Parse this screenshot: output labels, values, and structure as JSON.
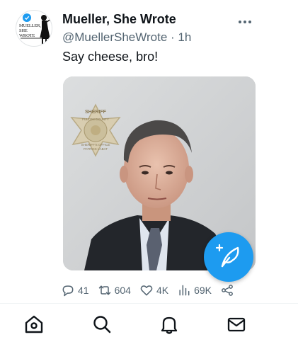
{
  "tweet": {
    "avatar_text": "Mueller, She Wrote",
    "display_name": "Mueller, She Wrote",
    "handle": "@MuellerSheWrote",
    "separator": "·",
    "time": "1h",
    "text": "Say cheese, bro!",
    "media": {
      "badge_label": "SHERIFF",
      "badge_county": "FULTON COUNTY",
      "badge_office": "SHERIFF'S OFFICE",
      "badge_name": "PATRICK LABAT"
    },
    "actions": {
      "replies": "41",
      "retweets": "604",
      "likes": "4K",
      "views": "69K"
    }
  },
  "colors": {
    "accent": "#1d9bf0",
    "text_primary": "#0f1419",
    "text_secondary": "#536471"
  },
  "icons": {
    "more": "more-horizontal-icon",
    "reply": "reply-icon",
    "retweet": "retweet-icon",
    "like": "heart-icon",
    "views": "views-bar-icon",
    "share": "share-icon",
    "compose": "compose-quill-icon",
    "tabs": [
      "home-icon",
      "search-icon",
      "notifications-icon",
      "messages-icon"
    ]
  }
}
